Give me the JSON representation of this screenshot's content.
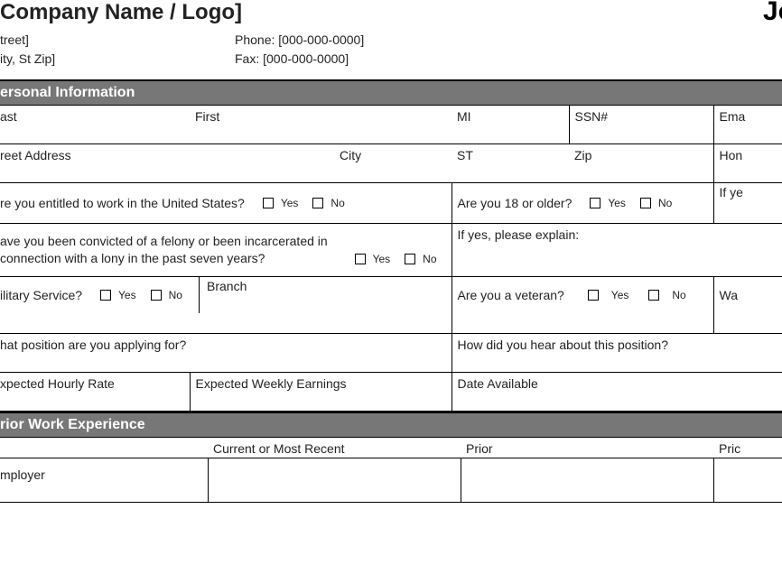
{
  "header": {
    "company_logo": "Company Name / Logo]",
    "street": "treet]",
    "city_st_zip": "ity, St Zip]",
    "phone_label": "Phone:",
    "phone_value": "[000-000-0000]",
    "fax_label": "Fax:",
    "fax_value": "[000-000-0000]",
    "title_right": "Jo"
  },
  "sections": {
    "personal": "ersonal Information",
    "prior_work": "rior Work Experience"
  },
  "labels": {
    "last": "ast",
    "first": "First",
    "mi": "MI",
    "ssn": "SSN#",
    "email": "Ema",
    "street_address": "reet Address",
    "city": "City",
    "st": "ST",
    "zip": "Zip",
    "home": "Hon",
    "work_entitled": "re you entitled to work in the United States?",
    "over18": "Are you 18 or older?",
    "if_ye": "If ye",
    "felony": "ave you been convicted of a felony or been incarcerated in connection with a lony in the past seven years?",
    "explain": "If yes, please explain:",
    "military": "ilitary Service?",
    "branch": "Branch",
    "veteran": "Are you a veteran?",
    "war": "Wa",
    "what_position": "hat position are you applying for?",
    "how_hear": "How did you hear about this position?",
    "hourly_rate": "xpected Hourly Rate",
    "weekly_earnings": "Expected Weekly Earnings",
    "date_available": "Date Available",
    "current_recent": "Current or Most Recent",
    "prior": "Prior",
    "prior2": "Pric",
    "employer": "mployer",
    "yes": "Yes",
    "no": "No"
  }
}
